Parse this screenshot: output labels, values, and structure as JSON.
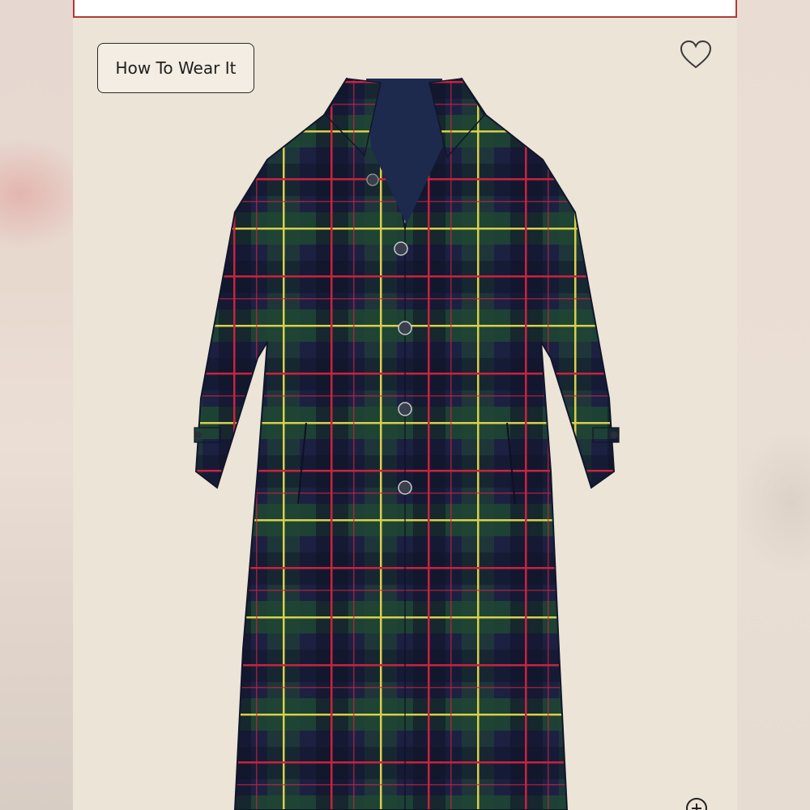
{
  "product": {
    "how_to_wear_label": "How To Wear It",
    "wishlist_icon": "heart-outline-icon",
    "zoom_icon": "zoom-plus-icon"
  },
  "colors": {
    "accent_border": "#b03a3a",
    "panel_background": "#ece4d7",
    "plaid_navy": "#1c2142",
    "plaid_green": "#1f4a36",
    "plaid_red": "#c8233f",
    "plaid_yellow": "#d8cf4a"
  }
}
